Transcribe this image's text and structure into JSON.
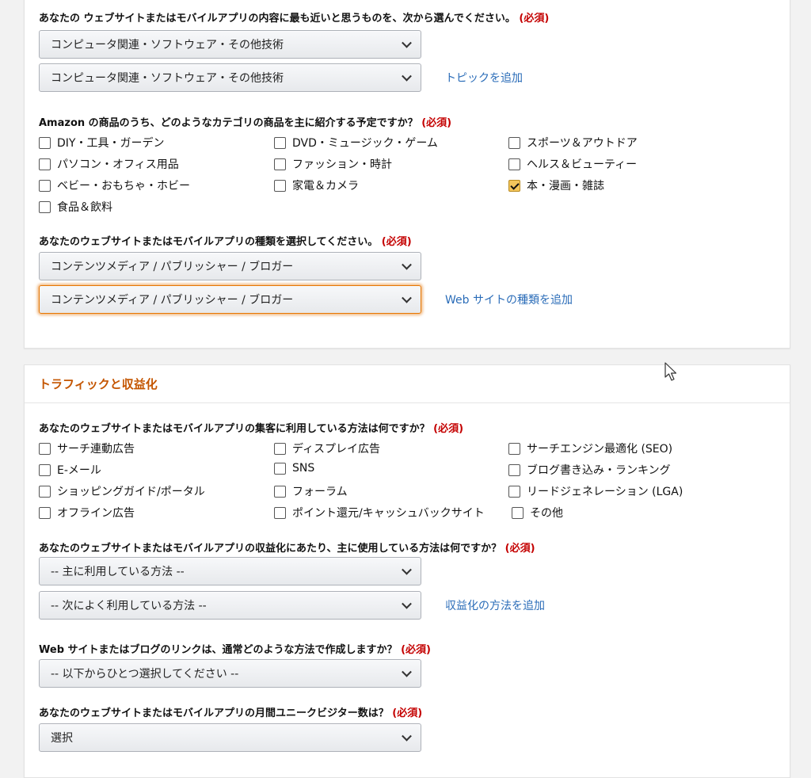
{
  "required": "(必須)",
  "card1": {
    "q_topic": "あなたの ウェブサイトまたはモバイルアプリの内容に最も近いと思うものを、次から選んでください。",
    "topic_select_1": "コンピュータ関連・ソフトウェア・その他技術",
    "topic_select_2": "コンピュータ関連・ソフトウェア・その他技術",
    "add_topic_link": "トピックを追加",
    "q_category": "Amazon の商品のうち、どのようなカテゴリの商品を主に紹介する予定ですか？",
    "categories": [
      {
        "label": "DIY・工具・ガーデン",
        "checked": false
      },
      {
        "label": "DVD・ミュージック・ゲーム",
        "checked": false
      },
      {
        "label": "スポーツ＆アウトドア",
        "checked": false
      },
      {
        "label": "パソコン・オフィス用品",
        "checked": false
      },
      {
        "label": "ファッション・時計",
        "checked": false
      },
      {
        "label": "ヘルス＆ビューティー",
        "checked": false
      },
      {
        "label": "ベビー・おもちゃ・ホビー",
        "checked": false
      },
      {
        "label": "家電＆カメラ",
        "checked": false
      },
      {
        "label": "本・漫画・雑誌",
        "checked": true
      },
      {
        "label": "食品＆飲料",
        "checked": false
      }
    ],
    "q_type": "あなたのウェブサイトまたはモバイルアプリの種類を選択してください。",
    "type_select_1": "コンテンツメディア / パブリッシャー / ブロガー",
    "type_select_2": "コンテンツメディア / パブリッシャー / ブロガー",
    "add_type_link": "Web サイトの種類を追加"
  },
  "card2": {
    "title": "トラフィックと収益化",
    "q_traffic": "あなたのウェブサイトまたはモバイルアプリの集客に利用している方法は何ですか？",
    "traffic_methods": [
      {
        "label": "サーチ連動広告",
        "checked": false
      },
      {
        "label": "ディスプレイ広告",
        "checked": false
      },
      {
        "label": "サーチエンジン最適化 (SEO)",
        "checked": false
      },
      {
        "label": "E-メール",
        "checked": false
      },
      {
        "label": "SNS",
        "checked": false
      },
      {
        "label": "ブログ書き込み・ランキング",
        "checked": false
      },
      {
        "label": "ショッピングガイド/ポータル",
        "checked": false
      },
      {
        "label": "フォーラム",
        "checked": false
      },
      {
        "label": "リードジェネレーション (LGA)",
        "checked": false
      },
      {
        "label": "オフライン広告",
        "checked": false
      },
      {
        "label": "ポイント還元/キャッシュバックサイト",
        "checked": false
      },
      {
        "label": "その他",
        "checked": false
      }
    ],
    "q_monetize": "あなたのウェブサイトまたはモバイルアプリの収益化にあたり、主に使用している方法は何ですか？",
    "monetize_select_1": "-- 主に利用している方法 --",
    "monetize_select_2": "-- 次によく利用している方法 --",
    "add_monetize_link": "収益化の方法を追加",
    "q_links": "Web サイトまたはブログのリンクは、通常どのような方法で作成しますか？",
    "links_select": "-- 以下からひとつ選択してください --",
    "q_visitors": "あなたのウェブサイトまたはモバイルアプリの月間ユニークビジター数は？",
    "visitors_select": "選択"
  }
}
